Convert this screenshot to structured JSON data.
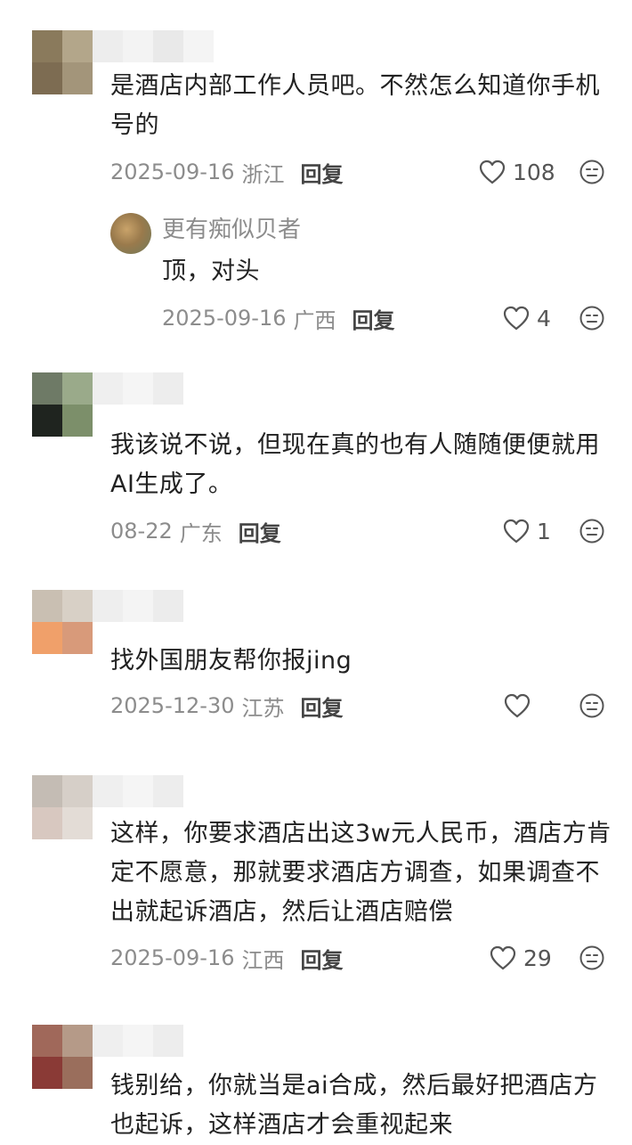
{
  "comments": [
    {
      "text_lines": [
        "是酒店内部工作人员吧。不然怎么知道你手机",
        "号的"
      ],
      "date": "2025-09-16",
      "region": "浙江",
      "reply": "回复",
      "likes": "108"
    },
    {
      "text_lines": [
        "我该说不说，但现在真的也有人随随便便就用",
        "AI生成了。"
      ],
      "date": "08-22",
      "region": "广东",
      "reply": "回复",
      "likes": "1"
    },
    {
      "text_lines": [
        "找外国朋友帮你报jing"
      ],
      "date": "2025-12-30",
      "region": "江苏",
      "reply": "回复",
      "likes": ""
    },
    {
      "text_lines": [
        "这样，你要求酒店出这3w元人民币，酒店方肯",
        "定不愿意，那就要求酒店方调查，如果调查不",
        "出就起诉酒店，然后让酒店赔偿"
      ],
      "date": "2025-09-16",
      "region": "江西",
      "reply": "回复",
      "likes": "29"
    },
    {
      "text_lines": [
        "钱别给，你就当是ai合成，然后最好把酒店方",
        "也起诉，这样酒店才会重视起来"
      ]
    }
  ],
  "sub_reply": {
    "name": "更有痴似贝者",
    "text": "顶，对头",
    "date": "2025-09-16",
    "region": "广西",
    "reply": "回复",
    "likes": "4"
  },
  "icons": {
    "like": "heart-outline-icon",
    "emoji": "neutral-face-icon"
  },
  "colors": {
    "meta_gray": "#8c8c8c",
    "text": "#222222"
  }
}
